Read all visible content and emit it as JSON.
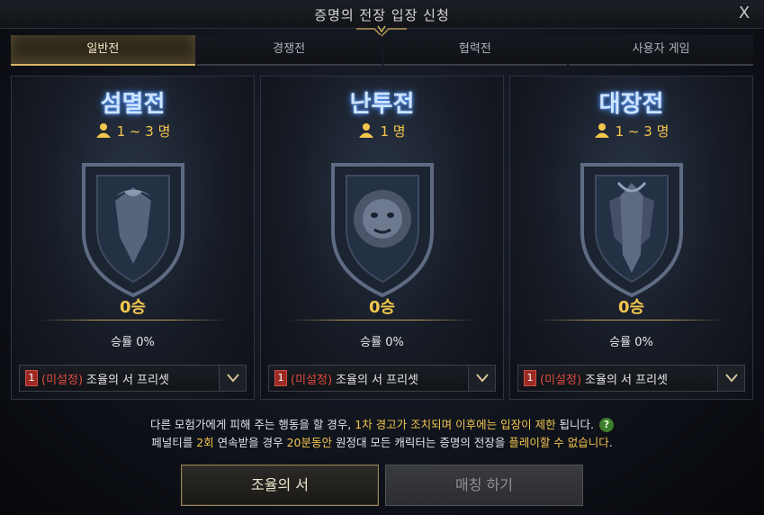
{
  "window": {
    "title": "증명의 전장 입장 신청",
    "close_glyph": "X"
  },
  "tabs": [
    {
      "label": "일반전",
      "active": true
    },
    {
      "label": "경쟁전",
      "active": false
    },
    {
      "label": "협력전",
      "active": false
    },
    {
      "label": "사용자 게임",
      "active": false
    }
  ],
  "modes": [
    {
      "title": "섬멸전",
      "players": "1 ~ 3 명",
      "wins": "0승",
      "winrate": "승률 0%",
      "preset": {
        "num": "1",
        "unset": "(미설정)",
        "label": "조율의 서 프리셋"
      }
    },
    {
      "title": "난투전",
      "players": "1 명",
      "wins": "0승",
      "winrate": "승률 0%",
      "preset": {
        "num": "1",
        "unset": "(미설정)",
        "label": "조율의 서 프리셋"
      }
    },
    {
      "title": "대장전",
      "players": "1 ~ 3 명",
      "wins": "0승",
      "winrate": "승률 0%",
      "preset": {
        "num": "1",
        "unset": "(미설정)",
        "label": "조율의 서 프리셋"
      }
    }
  ],
  "notice": {
    "line1_a": "다른 모험가에게 피해 주는 행동을 할 경우, ",
    "line1_hl1": "1차 경고가 조치되며 이후에는 입장이 제한",
    "line1_b": " 됩니다.",
    "line2_a": "페널티를 ",
    "line2_hl1": "2회",
    "line2_b": " 연속받을 경우 ",
    "line2_hl2": "20분동안",
    "line2_c": " 원정대 모든 캐릭터는 증명의 전장을 ",
    "line2_hl3": "플레이할 수 없습니다",
    "line2_d": ".",
    "help_glyph": "?"
  },
  "buttons": {
    "primary": "조율의 서",
    "match": "매칭 하기"
  },
  "colors": {
    "accent_gold": "#f3c64d",
    "title_glow": "#4a90ff",
    "unset_red": "#e04a3c",
    "help_green": "#3e7d2a"
  },
  "icons": [
    "close-icon",
    "person-icon",
    "shield-emblem-icon",
    "dropdown-chevron-icon",
    "help-icon"
  ]
}
